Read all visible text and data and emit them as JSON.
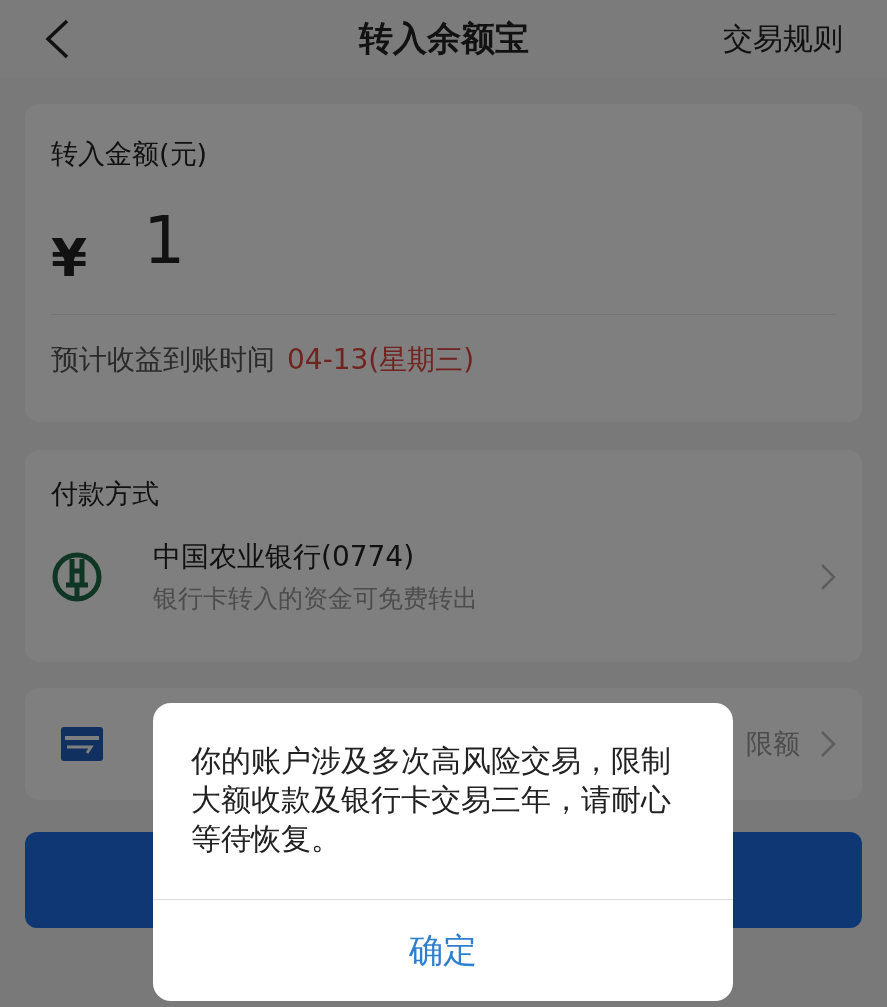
{
  "header": {
    "title": "转入余额宝",
    "action": "交易规则"
  },
  "amount_card": {
    "label": "转入金额(元)",
    "currency": "¥",
    "value": "1",
    "estimate_label": "预计收益到账时间",
    "estimate_date": "04-13(星期三)"
  },
  "payment": {
    "label": "付款方式",
    "methods": [
      {
        "kind": "bank",
        "name": "中国农业银行(0774)",
        "note": "银行卡转入的资金可免费转出"
      },
      {
        "kind": "card",
        "limit": "限额"
      }
    ]
  },
  "dialog": {
    "message": "你的账户涉及多次高风险交易，限制大额收款及银行卡交易三年，请耐心等待恢复。",
    "buttons": [
      "确定"
    ]
  }
}
